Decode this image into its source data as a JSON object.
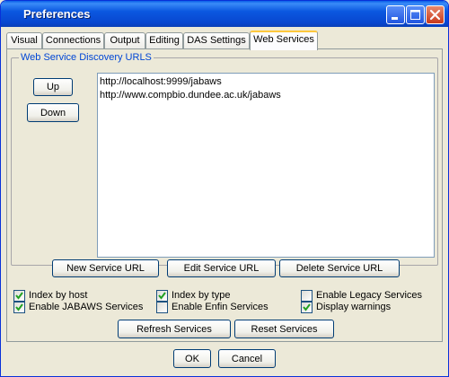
{
  "window": {
    "title": "Preferences"
  },
  "tabs": [
    {
      "label": "Visual"
    },
    {
      "label": "Connections"
    },
    {
      "label": "Output"
    },
    {
      "label": "Editing"
    },
    {
      "label": "DAS Settings"
    },
    {
      "label": "Web Services",
      "active": true
    }
  ],
  "discovery": {
    "group_title": "Web Service Discovery URLS",
    "up_label": "Up",
    "down_label": "Down",
    "urls": [
      "http://localhost:9999/jabaws",
      "http://www.compbio.dundee.ac.uk/jabaws"
    ],
    "new_label": "New Service URL",
    "edit_label": "Edit Service URL",
    "delete_label": "Delete Service URL"
  },
  "options": {
    "index_by_host": {
      "label": "Index by host",
      "checked": true
    },
    "index_by_type": {
      "label": "Index by type",
      "checked": true
    },
    "enable_legacy": {
      "label": "Enable Legacy Services",
      "checked": false
    },
    "enable_jabaws": {
      "label": "Enable JABAWS Services",
      "checked": true
    },
    "enable_enfin": {
      "label": "Enable Enfin Services",
      "checked": false
    },
    "display_warnings": {
      "label": "Display warnings",
      "checked": true
    }
  },
  "services": {
    "refresh_label": "Refresh Services",
    "reset_label": "Reset Services"
  },
  "dialog": {
    "ok_label": "OK",
    "cancel_label": "Cancel"
  },
  "colors": {
    "accent": "#0046d5",
    "check_mark": "#21a121"
  }
}
